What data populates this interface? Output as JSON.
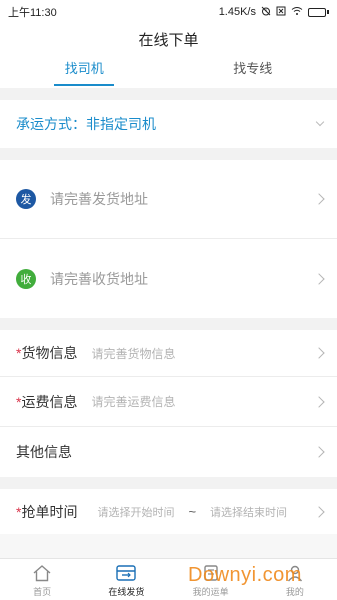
{
  "status_bar": {
    "time": "上午11:30",
    "speed": "1.45K/s",
    "battery_level": 0.9,
    "battery_color": "#3bb54a"
  },
  "header": {
    "title": "在线下单"
  },
  "tabs": [
    {
      "label": "找司机",
      "active": true
    },
    {
      "label": "找专线",
      "active": false
    }
  ],
  "mode": {
    "label": "承运方式：非指定司机"
  },
  "addresses": {
    "send_badge": "发",
    "send_placeholder": "请完善发货地址",
    "recv_badge": "收",
    "recv_placeholder": "请完善收货地址"
  },
  "fields": {
    "required_mark": "*",
    "cargo_label": "货物信息",
    "cargo_placeholder": "请完善货物信息",
    "freight_label": "运费信息",
    "freight_placeholder": "请完善运费信息",
    "other_label": "其他信息"
  },
  "grab_time": {
    "label": "抢单时间",
    "start_placeholder": "请选择开始时间",
    "separator": "~",
    "end_placeholder": "请选择结束时间"
  },
  "bottom_nav": [
    {
      "label": "首页",
      "icon": "home-icon"
    },
    {
      "label": "在线发货",
      "icon": "truck-box-icon",
      "active": true
    },
    {
      "label": "我的运单",
      "icon": "waybill-icon"
    },
    {
      "label": "我的",
      "icon": "user-icon"
    }
  ],
  "watermark": "Downyi.com",
  "colors": {
    "accent": "#1a8ccb",
    "required": "#d9344a",
    "send": "#1d58a3",
    "recv": "#41ad3c"
  }
}
